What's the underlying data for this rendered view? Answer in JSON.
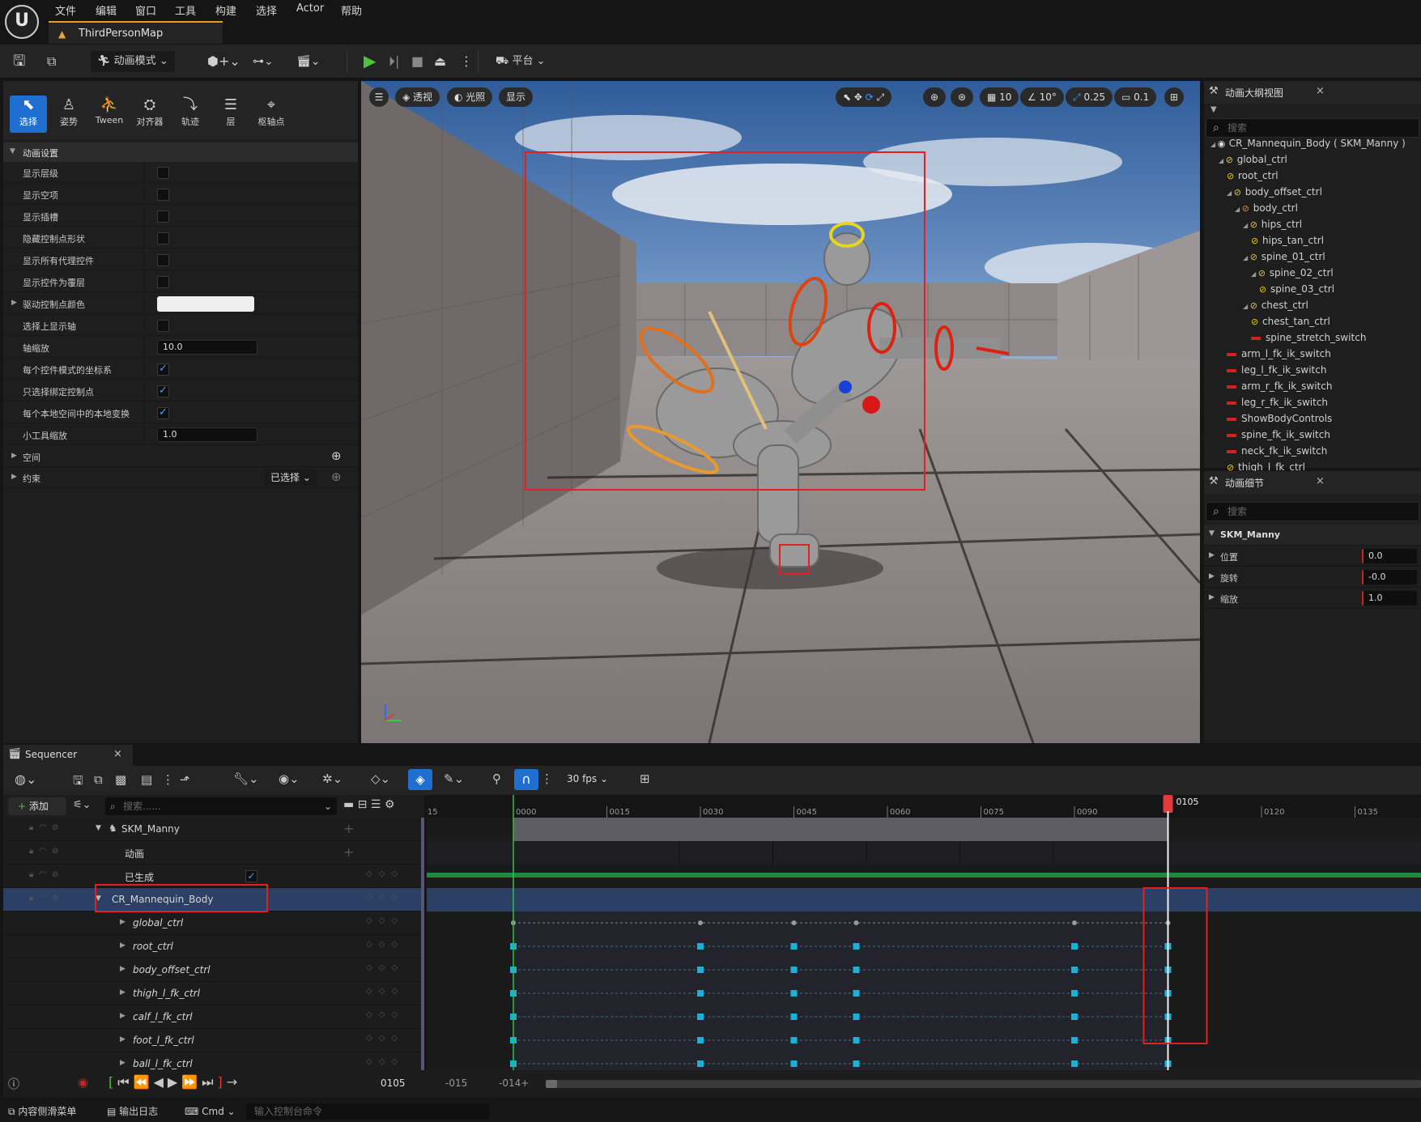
{
  "menu": [
    "文件",
    "编辑",
    "窗口",
    "工具",
    "构建",
    "选择",
    "Actor",
    "帮助"
  ],
  "logo_text": "U",
  "level_tab": "ThirdPersonMap",
  "toolbar": {
    "mode": "动画模式",
    "platform": "平台"
  },
  "modes": [
    {
      "icon": "cursor-icon",
      "glyph": "⬉",
      "label": "选择"
    },
    {
      "icon": "pose-icon",
      "glyph": "♙",
      "label": "姿势"
    },
    {
      "icon": "tween-icon",
      "glyph": "⛹",
      "label": "Tween"
    },
    {
      "icon": "aligner-icon",
      "glyph": "⛭",
      "label": "对齐器"
    },
    {
      "icon": "trail-icon",
      "glyph": "⤵",
      "label": "轨迹"
    },
    {
      "icon": "layer-icon",
      "glyph": "☰",
      "label": "层"
    },
    {
      "icon": "pivot-icon",
      "glyph": "⌖",
      "label": "枢轴点"
    }
  ],
  "anim_settings": {
    "header": "动画设置",
    "rows": [
      {
        "label": "显示层级",
        "type": "checkbox",
        "checked": false
      },
      {
        "label": "显示空项",
        "type": "checkbox",
        "checked": false
      },
      {
        "label": "显示插槽",
        "type": "checkbox",
        "checked": false
      },
      {
        "label": "隐藏控制点形状",
        "type": "checkbox",
        "checked": false
      },
      {
        "label": "显示所有代理控件",
        "type": "checkbox",
        "checked": false
      },
      {
        "label": "显示控件为覆层",
        "type": "checkbox",
        "checked": false
      },
      {
        "label": "驱动控制点颜色",
        "type": "color",
        "color": "#efefef"
      },
      {
        "label": "选择上显示轴",
        "type": "checkbox",
        "checked": false
      },
      {
        "label": "轴缩放",
        "type": "number",
        "value": "10.0"
      },
      {
        "label": "每个控件模式的坐标系",
        "type": "checkbox",
        "checked": true
      },
      {
        "label": "只选择绑定控制点",
        "type": "checkbox",
        "checked": true
      },
      {
        "label": "每个本地空间中的本地变换",
        "type": "checkbox",
        "checked": true
      },
      {
        "label": "小工具缩放",
        "type": "number",
        "value": "1.0"
      }
    ],
    "space": "空间",
    "constraint": "约束",
    "constraint_dropdown": "已选择"
  },
  "viewport": {
    "perspective": "透视",
    "lighting": "光照",
    "show": "显示",
    "grid": "10",
    "angle": "10°",
    "scale": "0.25",
    "camera": "0.1"
  },
  "outliner": {
    "title": "动画大纲视图",
    "search_placeholder": "搜索",
    "items": [
      {
        "label": "CR_Mannequin_Body ( SKM_Manny )",
        "type": "root"
      },
      {
        "label": "global_ctrl",
        "type": "ctrl"
      },
      {
        "label": "root_ctrl",
        "type": "ctrl"
      },
      {
        "label": "body_offset_ctrl",
        "type": "ctrl"
      },
      {
        "label": "body_ctrl",
        "type": "ctrl-orange"
      },
      {
        "label": "hips_ctrl",
        "type": "ctrl"
      },
      {
        "label": "hips_tan_ctrl",
        "type": "ctrl"
      },
      {
        "label": "spine_01_ctrl",
        "type": "ctrl"
      },
      {
        "label": "spine_02_ctrl",
        "type": "ctrl"
      },
      {
        "label": "spine_03_ctrl",
        "type": "ctrl"
      },
      {
        "label": "chest_ctrl",
        "type": "ctrl"
      },
      {
        "label": "chest_tan_ctrl",
        "type": "ctrl"
      },
      {
        "label": "spine_stretch_switch",
        "type": "switch"
      },
      {
        "label": "arm_l_fk_ik_switch",
        "type": "switch"
      },
      {
        "label": "leg_l_fk_ik_switch",
        "type": "switch"
      },
      {
        "label": "arm_r_fk_ik_switch",
        "type": "switch"
      },
      {
        "label": "leg_r_fk_ik_switch",
        "type": "switch"
      },
      {
        "label": "ShowBodyControls",
        "type": "switch"
      },
      {
        "label": "spine_fk_ik_switch",
        "type": "switch"
      },
      {
        "label": "neck_fk_ik_switch",
        "type": "switch"
      },
      {
        "label": "thigh_l_fk_ctrl",
        "type": "ctrl"
      }
    ]
  },
  "details": {
    "title": "动画细节",
    "search_placeholder": "搜索",
    "section": "SKM_Manny",
    "rows": [
      {
        "label": "位置",
        "value": "0.0"
      },
      {
        "label": "旋转",
        "value": "-0.0"
      },
      {
        "label": "缩放",
        "value": "1.0"
      }
    ]
  },
  "sequencer": {
    "tab": "Sequencer",
    "add": "添加",
    "search_placeholder": "搜索......",
    "fps": "30 fps",
    "tracks": [
      {
        "label": "SKM_Manny",
        "italic": false
      },
      {
        "label": "动画",
        "italic": false
      },
      {
        "label": "已生成",
        "italic": false
      },
      {
        "label": "CR_Mannequin_Body",
        "italic": false
      },
      {
        "label": "global_ctrl",
        "italic": true
      },
      {
        "label": "root_ctrl",
        "italic": true
      },
      {
        "label": "body_offset_ctrl",
        "italic": true
      },
      {
        "label": "thigh_l_fk_ctrl",
        "italic": true
      },
      {
        "label": "calf_l_fk_ctrl",
        "italic": true
      },
      {
        "label": "foot_l_fk_ctrl",
        "italic": true
      },
      {
        "label": "ball_l_fk_ctrl",
        "italic": true
      }
    ],
    "ruler_labels": [
      "015",
      "0000",
      "0015",
      "0030",
      "0045",
      "0060",
      "0075",
      "0090",
      "0120",
      "0135"
    ],
    "playhead": "0105",
    "keyframes": [
      0,
      30,
      45,
      55,
      90,
      105
    ],
    "current_frame": "0105",
    "range_start": "-015",
    "range_end": "-014+"
  },
  "statusbar": {
    "content_drawer": "内容侧滑菜单",
    "output_log": "输出日志",
    "cmd": "Cmd",
    "cmd_placeholder": "输入控制台命令"
  },
  "colors": {
    "accent": "#1f6fd1",
    "key": "#1ab0d8",
    "playhead": "#e23a3a",
    "selection": "#d11"
  }
}
